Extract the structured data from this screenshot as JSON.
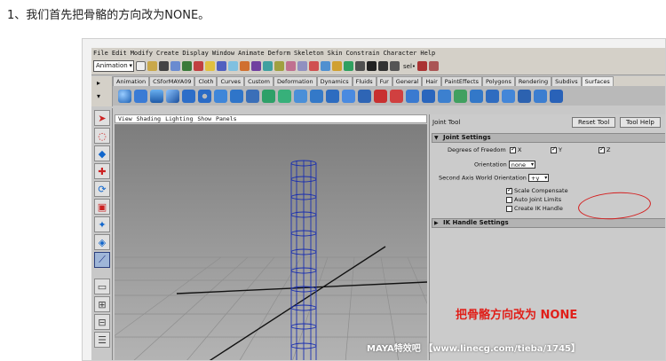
{
  "caption": "1、我们首先把骨骼的方向改为NONE。",
  "menu": [
    "File",
    "Edit",
    "Modify",
    "Create",
    "Display",
    "Window",
    "Animate",
    "Deform",
    "Skeleton",
    "Skin",
    "Constrain",
    "Character",
    "Help"
  ],
  "toolbar": {
    "mode": "Animation",
    "sel_label": "sel•"
  },
  "shelf_tabs": [
    "Animation",
    "CSforMAYA09",
    "Cloth",
    "Curves",
    "Custom",
    "Deformation",
    "Dynamics",
    "Fluids",
    "Fur",
    "General",
    "Hair",
    "PaintEffects",
    "Polygons",
    "Rendering",
    "Subdivs",
    "Surfaces"
  ],
  "viewport_menu": [
    "View",
    "Shading",
    "Lighting",
    "Show",
    "Panels"
  ],
  "tool_settings": {
    "title": "Joint Tool",
    "reset_label": "Reset Tool",
    "help_label": "Tool Help",
    "joint_settings_label": "Joint Settings",
    "dof_label": "Degrees of Freedom",
    "dof_x": "X",
    "dof_y": "Y",
    "dof_z": "Z",
    "orientation_label": "Orientation",
    "orientation_value": "none",
    "second_axis_label": "Second Axis World Orientation",
    "second_axis_value": "+y",
    "scale_compensate": "Scale Compensate",
    "auto_joint_limits": "Auto Joint Limits",
    "create_ik_handle": "Create IK Handle",
    "ik_handle_settings": "IK Handle Settings"
  },
  "annotation": "把骨骼方向改为 NONE",
  "watermark": "MAYA特效吧 【www.linecg.com/tieba/1745】"
}
